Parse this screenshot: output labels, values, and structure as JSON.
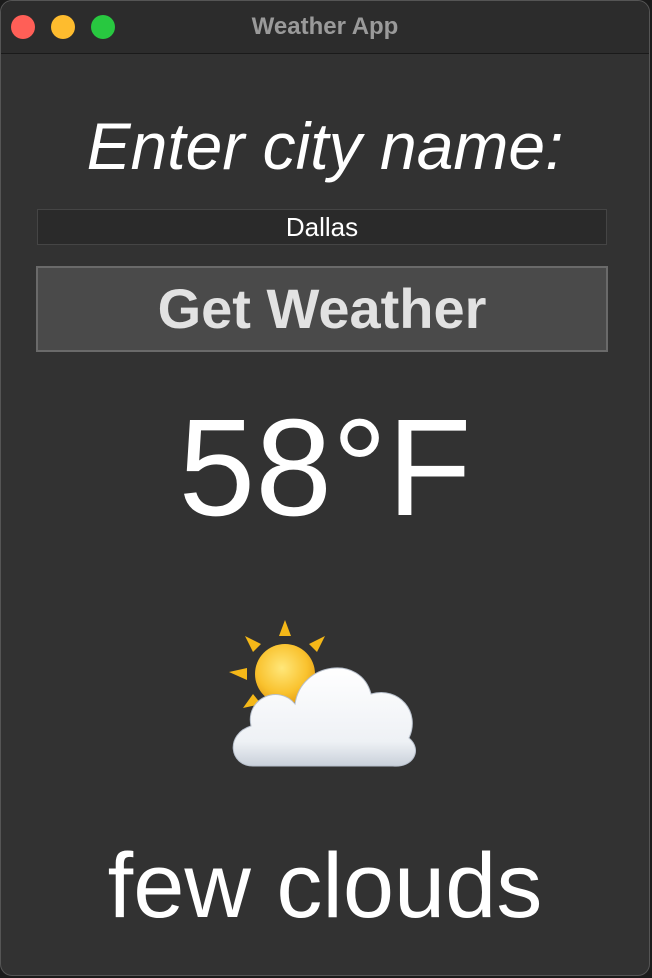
{
  "window": {
    "title": "Weather App"
  },
  "form": {
    "prompt": "Enter city name:",
    "city_value": "Dallas",
    "button_label": "Get Weather"
  },
  "weather": {
    "temperature": "58°F",
    "icon": "sun-behind-cloud-icon",
    "description": "few clouds"
  },
  "colors": {
    "window_bg": "#323232",
    "titlebar_bg": "#2c2c2c",
    "button_bg": "#4a4a4a",
    "text": "#ffffff",
    "close": "#ff5f57",
    "minimize": "#febc2e",
    "zoom": "#28c840"
  }
}
